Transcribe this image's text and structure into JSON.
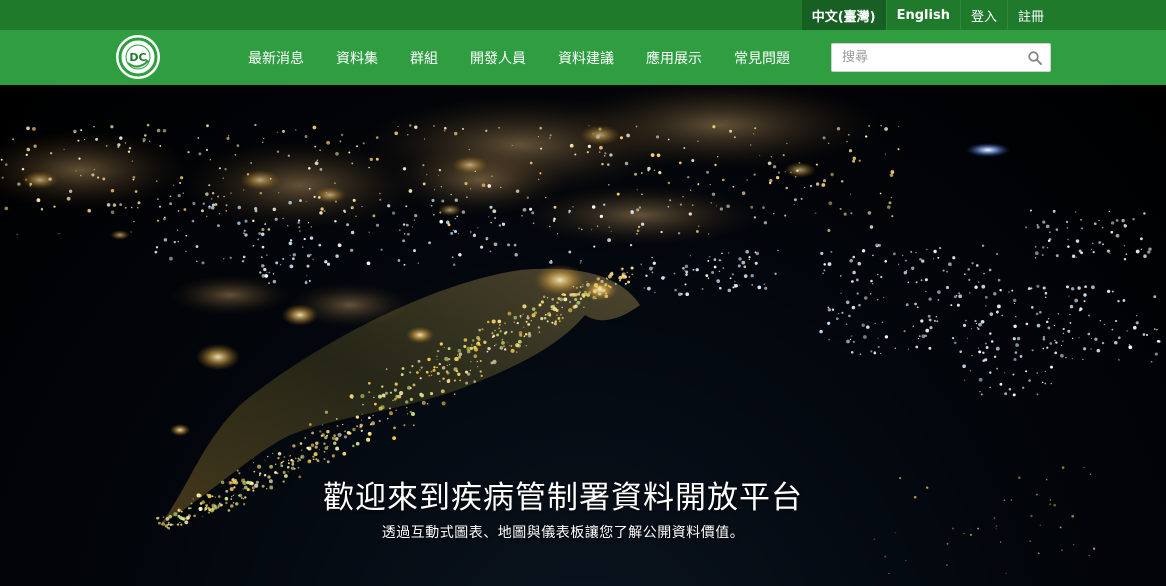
{
  "topbar": {
    "items": [
      {
        "label": "中文(臺灣)"
      },
      {
        "label": "English"
      },
      {
        "label": "登入"
      },
      {
        "label": "註冊"
      }
    ]
  },
  "header": {
    "logo_icon": "cdc-logo",
    "logo_text": "DC",
    "nav": [
      {
        "label": "最新消息"
      },
      {
        "label": "資料集"
      },
      {
        "label": "群組"
      },
      {
        "label": "開發人員"
      },
      {
        "label": "資料建議"
      },
      {
        "label": "應用展示"
      },
      {
        "label": "常見問題"
      }
    ],
    "search": {
      "placeholder": "搜尋",
      "value": "",
      "icon": "search-icon"
    }
  },
  "hero": {
    "title": "歡迎來到疾病管制署資料開放平台",
    "subtitle": "透過互動式圖表、地圖與儀表板讓您了解公開資料價值。",
    "background": "night-satellite-view-of-taiwan"
  },
  "colors": {
    "topbar_bg": "#1f7a2c",
    "navbar_bg": "#2e9e41",
    "accent": "#2e9e41"
  }
}
